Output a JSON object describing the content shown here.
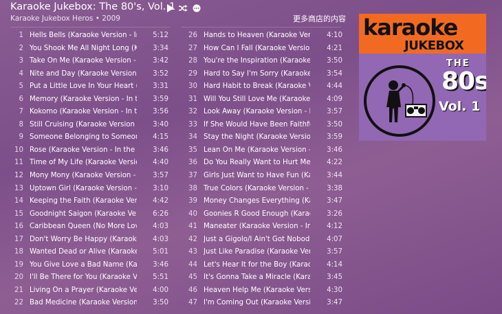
{
  "album": {
    "title": "Karaoke Jukebox: The 80's, Vol. 1",
    "artist_year": "Karaoke Jukebox Heros • 2009"
  },
  "controls": {
    "play_icon": "play-icon",
    "shuffle_icon": "shuffle-icon",
    "more_icon": "more-icon"
  },
  "store_link": "更多商店的内容",
  "cover": {
    "word1": "karaoke",
    "word2": "JUKEBOX",
    "the": "THE",
    "eighties": "80s",
    "vol": "Vol. 1",
    "colors": {
      "top": "#f26a22",
      "body": "#9267b3"
    }
  },
  "tracks_left": [
    {
      "num": "1",
      "name": "Hells Bells (Karaoke Version - In t...",
      "duration": "5:12"
    },
    {
      "num": "2",
      "name": "You Shook Me All Night Long (K...",
      "duration": "3:34"
    },
    {
      "num": "3",
      "name": "Take On Me (Karaoke Version - I...",
      "duration": "3:42"
    },
    {
      "num": "4",
      "name": "Nite and Day (Karaoke Version -...",
      "duration": "3:52"
    },
    {
      "num": "5",
      "name": "Put a Little Love In Your Heart (K...",
      "duration": "3:31"
    },
    {
      "num": "6",
      "name": "Memory (Karaoke Version - In th...",
      "duration": "3:59"
    },
    {
      "num": "7",
      "name": "Kokomo (Karaoke Version - In th...",
      "duration": "3:56"
    },
    {
      "num": "8",
      "name": "Still Cruising (Karaoke Version - I...",
      "duration": "3:40"
    },
    {
      "num": "9",
      "name": "Someone Belonging to Someone...",
      "duration": "4:15"
    },
    {
      "num": "10",
      "name": "Rose (Karaoke Version - In the St...",
      "duration": "3:46"
    },
    {
      "num": "11",
      "name": "Time of My Life (Karaoke Version...",
      "duration": "4:40"
    },
    {
      "num": "12",
      "name": "Mony Mony (Karaoke Version - I...",
      "duration": "3:57"
    },
    {
      "num": "13",
      "name": "Uptown Girl (Karaoke Version - I...",
      "duration": "3:10"
    },
    {
      "num": "14",
      "name": "Keeping the Faith (Karaoke Versi...",
      "duration": "4:42"
    },
    {
      "num": "15",
      "name": "Goodnight Saigon (Karaoke Versi...",
      "duration": "6:26"
    },
    {
      "num": "16",
      "name": "Caribbean Queen (No More Love...",
      "duration": "4:03"
    },
    {
      "num": "17",
      "name": "Don't Worry Be Happy (Karaoke...",
      "duration": "4:03"
    },
    {
      "num": "18",
      "name": "Wanted Dead or Alive (Karaoke...",
      "duration": "5:01"
    },
    {
      "num": "19",
      "name": "You Give Love a Bad Name (Kara...",
      "duration": "3:46"
    },
    {
      "num": "20",
      "name": "I'll Be There for You (Karaoke Ver...",
      "duration": "5:51"
    },
    {
      "num": "21",
      "name": "Living On a Prayer (Karaoke Versi...",
      "duration": "4:00"
    },
    {
      "num": "22",
      "name": "Bad Medicine (Karaoke Version -...",
      "duration": "3:50"
    }
  ],
  "tracks_right": [
    {
      "num": "26",
      "name": "Hands to Heaven (Karaoke Versi...",
      "duration": "4:10"
    },
    {
      "num": "27",
      "name": "How Can I Fall (Karaoke Version...",
      "duration": "4:21"
    },
    {
      "num": "28",
      "name": "You're the Inspiration (Karaoke V...",
      "duration": "3:50"
    },
    {
      "num": "29",
      "name": "Hard to Say I'm Sorry (Karaoke V...",
      "duration": "3:54"
    },
    {
      "num": "30",
      "name": "Hard Habit to Break (Karaoke Ve...",
      "duration": "4:44"
    },
    {
      "num": "31",
      "name": "Will You Still Love Me (Karaoke V...",
      "duration": "4:09"
    },
    {
      "num": "32",
      "name": "Look Away (Karaoke Version - In...",
      "duration": "3:57"
    },
    {
      "num": "33",
      "name": "If She Would Have Been Faithful...",
      "duration": "3:50"
    },
    {
      "num": "34",
      "name": "Stay the Night (Karaoke Version...",
      "duration": "3:59"
    },
    {
      "num": "35",
      "name": "Lean On Me (Karaoke Version - I...",
      "duration": "3:46"
    },
    {
      "num": "36",
      "name": "Do You Really Want to Hurt Me (...",
      "duration": "4:22"
    },
    {
      "num": "37",
      "name": "Girls Just Want to Have Fun (Kar...",
      "duration": "3:44"
    },
    {
      "num": "38",
      "name": "True Colors (Karaoke Version - In...",
      "duration": "3:38"
    },
    {
      "num": "39",
      "name": "Money Changes Everything (Kara...",
      "duration": "3:47"
    },
    {
      "num": "40",
      "name": "Goonies R Good Enough (Karaok...",
      "duration": "3:26"
    },
    {
      "num": "41",
      "name": "Maneater (Karaoke Version - In t...",
      "duration": "4:12"
    },
    {
      "num": "42",
      "name": "Just a Gigolo/I Ain't Got Nobody...",
      "duration": "4:07"
    },
    {
      "num": "43",
      "name": "Just Like Paradise (Karaoke Versi...",
      "duration": "3:57"
    },
    {
      "num": "44",
      "name": "Let's Hear It for the Boy (Karaoke...",
      "duration": "4:14"
    },
    {
      "num": "45",
      "name": "It's Gonna Take a Miracle (Karao...",
      "duration": "3:45"
    },
    {
      "num": "46",
      "name": "Heaven Help Me (Karaoke Versio...",
      "duration": "4:30"
    },
    {
      "num": "47",
      "name": "I'm Coming Out (Karaoke Versio...",
      "duration": "3:47"
    }
  ]
}
